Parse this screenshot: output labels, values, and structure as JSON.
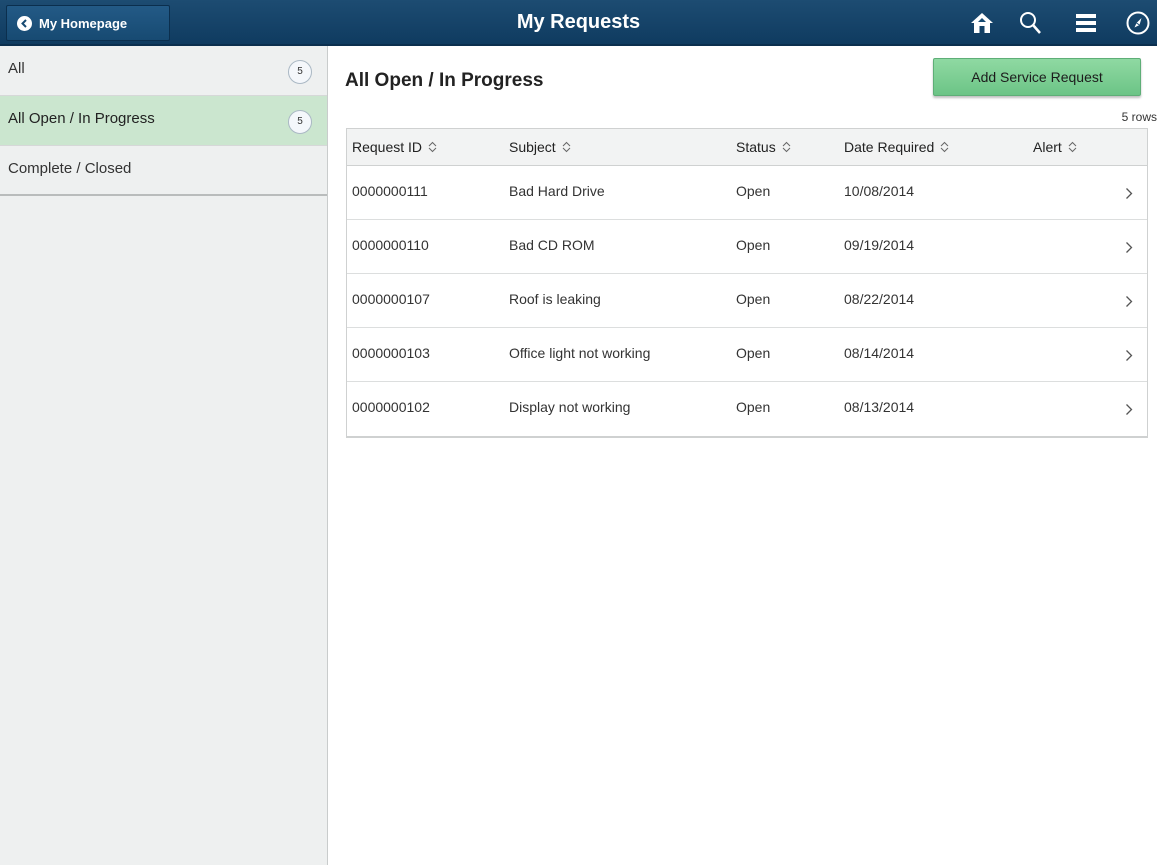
{
  "header": {
    "back_label": "My Homepage",
    "title": "My Requests",
    "icons": [
      "home-icon",
      "search-icon",
      "menu-icon",
      "navbar-icon"
    ]
  },
  "sidebar": {
    "items": [
      {
        "label": "All",
        "count": "5",
        "active": false
      },
      {
        "label": "All Open / In Progress",
        "count": "5",
        "active": true
      },
      {
        "label": "Complete / Closed",
        "count": "",
        "active": false
      }
    ]
  },
  "main": {
    "title": "All Open / In Progress",
    "add_button": "Add Service Request",
    "rows_count": "5 rows",
    "columns": [
      "Request ID",
      "Subject",
      "Status",
      "Date Required",
      "Alert"
    ],
    "rows": [
      {
        "id": "0000000111",
        "subject": "Bad Hard Drive",
        "status": "Open",
        "date": "10/08/2014",
        "alert": ""
      },
      {
        "id": "0000000110",
        "subject": "Bad CD ROM",
        "status": "Open",
        "date": "09/19/2014",
        "alert": ""
      },
      {
        "id": "0000000107",
        "subject": "Roof is leaking",
        "status": "Open",
        "date": "08/22/2014",
        "alert": ""
      },
      {
        "id": "0000000103",
        "subject": "Office light not working",
        "status": "Open",
        "date": "08/14/2014",
        "alert": ""
      },
      {
        "id": "0000000102",
        "subject": "Display not working",
        "status": "Open",
        "date": "08/13/2014",
        "alert": ""
      }
    ]
  },
  "colors": {
    "header_bg": "#174a72",
    "active_item_bg": "#cbe6cf",
    "add_button_bg": "#7ccf93"
  }
}
